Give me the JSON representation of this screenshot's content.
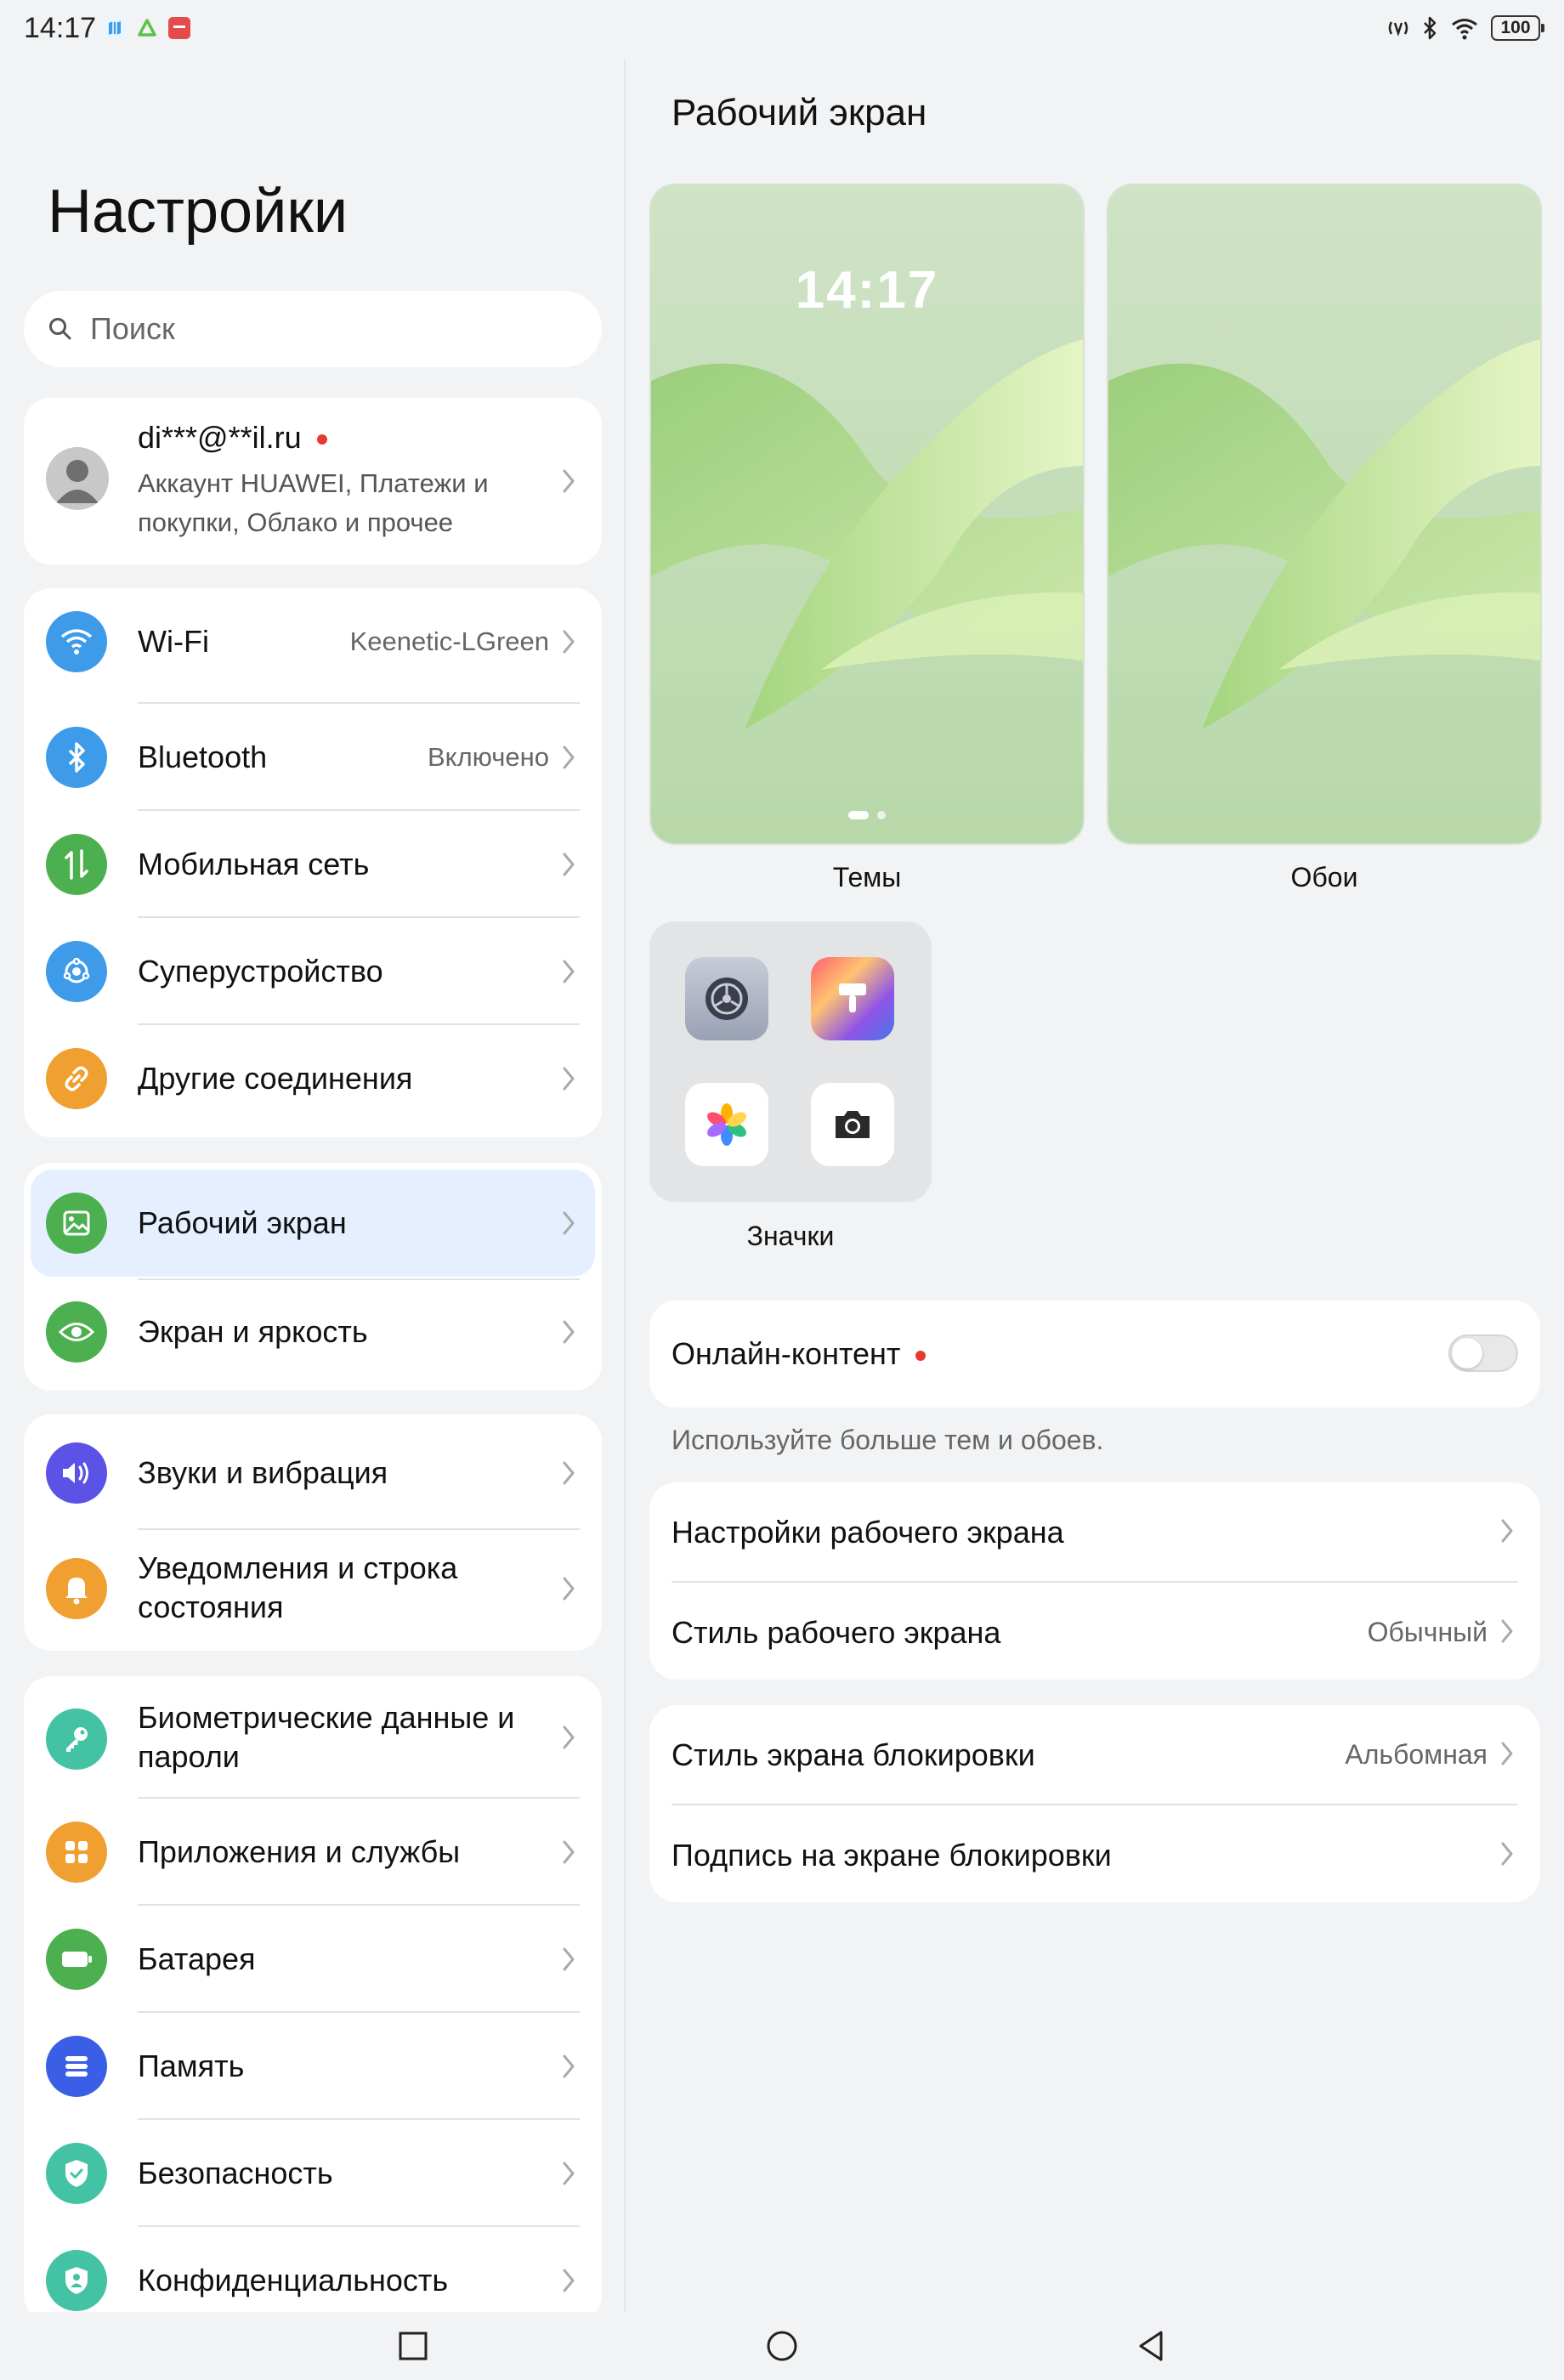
{
  "status_bar": {
    "time": "14:17",
    "battery": "100"
  },
  "left": {
    "title": "Настройки",
    "search_placeholder": "Поиск",
    "account": {
      "name": "di***@**il.ru",
      "subtitle": "Аккаунт HUAWEI, Платежи и покупки, Облако и прочее"
    },
    "items": [
      {
        "label": "Wi-Fi",
        "value": "Keenetic-LGreen",
        "icon": "wifi-icon",
        "color": "#3d9be9"
      },
      {
        "label": "Bluetooth",
        "value": "Включено",
        "icon": "bluetooth-icon",
        "color": "#3d9be9"
      },
      {
        "label": "Мобильная сеть",
        "value": "",
        "icon": "mobile-network-icon",
        "color": "#4caf50"
      },
      {
        "label": "Суперустройство",
        "value": "",
        "icon": "superdevice-icon",
        "color": "#3d9be9"
      },
      {
        "label": "Другие соединения",
        "value": "",
        "icon": "link-icon",
        "color": "#f0a030"
      },
      {
        "label": "Рабочий экран",
        "value": "",
        "icon": "wallpaper-icon",
        "color": "#4caf50"
      },
      {
        "label": "Экран и яркость",
        "value": "",
        "icon": "eye-icon",
        "color": "#4caf50"
      },
      {
        "label": "Звуки и вибрация",
        "value": "",
        "icon": "sound-icon",
        "color": "#5b53e6"
      },
      {
        "label": "Уведомления и строка состояния",
        "value": "",
        "icon": "bell-icon",
        "color": "#f0a030"
      },
      {
        "label": "Биометрические данные и пароли",
        "value": "",
        "icon": "key-icon",
        "color": "#43c2a4"
      },
      {
        "label": "Приложения и службы",
        "value": "",
        "icon": "apps-icon",
        "color": "#f0a030"
      },
      {
        "label": "Батарея",
        "value": "",
        "icon": "battery-icon",
        "color": "#4caf50"
      },
      {
        "label": "Память",
        "value": "",
        "icon": "storage-icon",
        "color": "#3a5ee6"
      },
      {
        "label": "Безопасность",
        "value": "",
        "icon": "shield-check-icon",
        "color": "#43c2a4"
      },
      {
        "label": "Конфиденциальность",
        "value": "",
        "icon": "privacy-icon",
        "color": "#43c2a4"
      }
    ]
  },
  "right": {
    "title": "Рабочий экран",
    "lock_preview_time": "14:17",
    "themes_label": "Темы",
    "wallpapers_label": "Обои",
    "icons_label": "Значки",
    "online_content_label": "Онлайн-контент",
    "online_content_enabled": false,
    "online_hint": "Используйте больше тем и обоев.",
    "home_settings_label": "Настройки рабочего экрана",
    "home_style_label": "Стиль рабочего экрана",
    "home_style_value": "Обычный",
    "lock_style_label": "Стиль экрана блокировки",
    "lock_style_value": "Альбомная",
    "lock_signature_label": "Подпись на экране блокировки"
  }
}
